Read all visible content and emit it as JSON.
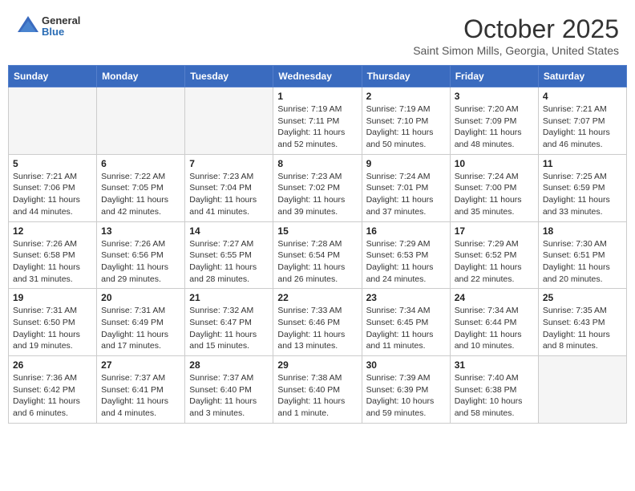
{
  "logo": {
    "general": "General",
    "blue": "Blue"
  },
  "header": {
    "month": "October 2025",
    "location": "Saint Simon Mills, Georgia, United States"
  },
  "weekdays": [
    "Sunday",
    "Monday",
    "Tuesday",
    "Wednesday",
    "Thursday",
    "Friday",
    "Saturday"
  ],
  "weeks": [
    [
      {
        "day": "",
        "sunrise": "",
        "sunset": "",
        "daylight": ""
      },
      {
        "day": "",
        "sunrise": "",
        "sunset": "",
        "daylight": ""
      },
      {
        "day": "",
        "sunrise": "",
        "sunset": "",
        "daylight": ""
      },
      {
        "day": "1",
        "sunrise": "Sunrise: 7:19 AM",
        "sunset": "Sunset: 7:11 PM",
        "daylight": "Daylight: 11 hours and 52 minutes."
      },
      {
        "day": "2",
        "sunrise": "Sunrise: 7:19 AM",
        "sunset": "Sunset: 7:10 PM",
        "daylight": "Daylight: 11 hours and 50 minutes."
      },
      {
        "day": "3",
        "sunrise": "Sunrise: 7:20 AM",
        "sunset": "Sunset: 7:09 PM",
        "daylight": "Daylight: 11 hours and 48 minutes."
      },
      {
        "day": "4",
        "sunrise": "Sunrise: 7:21 AM",
        "sunset": "Sunset: 7:07 PM",
        "daylight": "Daylight: 11 hours and 46 minutes."
      }
    ],
    [
      {
        "day": "5",
        "sunrise": "Sunrise: 7:21 AM",
        "sunset": "Sunset: 7:06 PM",
        "daylight": "Daylight: 11 hours and 44 minutes."
      },
      {
        "day": "6",
        "sunrise": "Sunrise: 7:22 AM",
        "sunset": "Sunset: 7:05 PM",
        "daylight": "Daylight: 11 hours and 42 minutes."
      },
      {
        "day": "7",
        "sunrise": "Sunrise: 7:23 AM",
        "sunset": "Sunset: 7:04 PM",
        "daylight": "Daylight: 11 hours and 41 minutes."
      },
      {
        "day": "8",
        "sunrise": "Sunrise: 7:23 AM",
        "sunset": "Sunset: 7:02 PM",
        "daylight": "Daylight: 11 hours and 39 minutes."
      },
      {
        "day": "9",
        "sunrise": "Sunrise: 7:24 AM",
        "sunset": "Sunset: 7:01 PM",
        "daylight": "Daylight: 11 hours and 37 minutes."
      },
      {
        "day": "10",
        "sunrise": "Sunrise: 7:24 AM",
        "sunset": "Sunset: 7:00 PM",
        "daylight": "Daylight: 11 hours and 35 minutes."
      },
      {
        "day": "11",
        "sunrise": "Sunrise: 7:25 AM",
        "sunset": "Sunset: 6:59 PM",
        "daylight": "Daylight: 11 hours and 33 minutes."
      }
    ],
    [
      {
        "day": "12",
        "sunrise": "Sunrise: 7:26 AM",
        "sunset": "Sunset: 6:58 PM",
        "daylight": "Daylight: 11 hours and 31 minutes."
      },
      {
        "day": "13",
        "sunrise": "Sunrise: 7:26 AM",
        "sunset": "Sunset: 6:56 PM",
        "daylight": "Daylight: 11 hours and 29 minutes."
      },
      {
        "day": "14",
        "sunrise": "Sunrise: 7:27 AM",
        "sunset": "Sunset: 6:55 PM",
        "daylight": "Daylight: 11 hours and 28 minutes."
      },
      {
        "day": "15",
        "sunrise": "Sunrise: 7:28 AM",
        "sunset": "Sunset: 6:54 PM",
        "daylight": "Daylight: 11 hours and 26 minutes."
      },
      {
        "day": "16",
        "sunrise": "Sunrise: 7:29 AM",
        "sunset": "Sunset: 6:53 PM",
        "daylight": "Daylight: 11 hours and 24 minutes."
      },
      {
        "day": "17",
        "sunrise": "Sunrise: 7:29 AM",
        "sunset": "Sunset: 6:52 PM",
        "daylight": "Daylight: 11 hours and 22 minutes."
      },
      {
        "day": "18",
        "sunrise": "Sunrise: 7:30 AM",
        "sunset": "Sunset: 6:51 PM",
        "daylight": "Daylight: 11 hours and 20 minutes."
      }
    ],
    [
      {
        "day": "19",
        "sunrise": "Sunrise: 7:31 AM",
        "sunset": "Sunset: 6:50 PM",
        "daylight": "Daylight: 11 hours and 19 minutes."
      },
      {
        "day": "20",
        "sunrise": "Sunrise: 7:31 AM",
        "sunset": "Sunset: 6:49 PM",
        "daylight": "Daylight: 11 hours and 17 minutes."
      },
      {
        "day": "21",
        "sunrise": "Sunrise: 7:32 AM",
        "sunset": "Sunset: 6:47 PM",
        "daylight": "Daylight: 11 hours and 15 minutes."
      },
      {
        "day": "22",
        "sunrise": "Sunrise: 7:33 AM",
        "sunset": "Sunset: 6:46 PM",
        "daylight": "Daylight: 11 hours and 13 minutes."
      },
      {
        "day": "23",
        "sunrise": "Sunrise: 7:34 AM",
        "sunset": "Sunset: 6:45 PM",
        "daylight": "Daylight: 11 hours and 11 minutes."
      },
      {
        "day": "24",
        "sunrise": "Sunrise: 7:34 AM",
        "sunset": "Sunset: 6:44 PM",
        "daylight": "Daylight: 11 hours and 10 minutes."
      },
      {
        "day": "25",
        "sunrise": "Sunrise: 7:35 AM",
        "sunset": "Sunset: 6:43 PM",
        "daylight": "Daylight: 11 hours and 8 minutes."
      }
    ],
    [
      {
        "day": "26",
        "sunrise": "Sunrise: 7:36 AM",
        "sunset": "Sunset: 6:42 PM",
        "daylight": "Daylight: 11 hours and 6 minutes."
      },
      {
        "day": "27",
        "sunrise": "Sunrise: 7:37 AM",
        "sunset": "Sunset: 6:41 PM",
        "daylight": "Daylight: 11 hours and 4 minutes."
      },
      {
        "day": "28",
        "sunrise": "Sunrise: 7:37 AM",
        "sunset": "Sunset: 6:40 PM",
        "daylight": "Daylight: 11 hours and 3 minutes."
      },
      {
        "day": "29",
        "sunrise": "Sunrise: 7:38 AM",
        "sunset": "Sunset: 6:40 PM",
        "daylight": "Daylight: 11 hours and 1 minute."
      },
      {
        "day": "30",
        "sunrise": "Sunrise: 7:39 AM",
        "sunset": "Sunset: 6:39 PM",
        "daylight": "Daylight: 10 hours and 59 minutes."
      },
      {
        "day": "31",
        "sunrise": "Sunrise: 7:40 AM",
        "sunset": "Sunset: 6:38 PM",
        "daylight": "Daylight: 10 hours and 58 minutes."
      },
      {
        "day": "",
        "sunrise": "",
        "sunset": "",
        "daylight": ""
      }
    ]
  ]
}
